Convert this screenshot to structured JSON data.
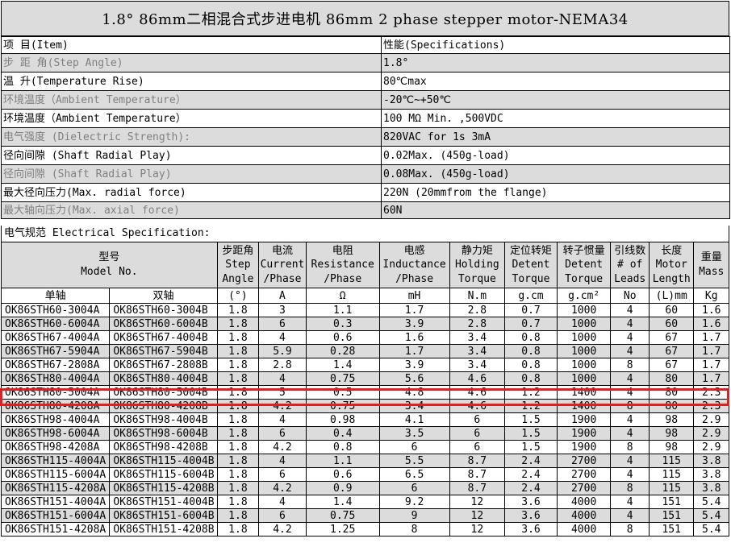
{
  "title": "1.8°  86mm二相混合式步进电机 86mm 2 phase stepper motor-NEMA34",
  "spec_header": {
    "item": "项    目(Item)",
    "value": "性能(Specifications)"
  },
  "specs": [
    {
      "label": "步 距 角(Step Angle)",
      "value": "1.8°",
      "gray": true
    },
    {
      "label": "温    升(Temperature Rise)",
      "value": "80℃max",
      "gray": false
    },
    {
      "label": "环境温度（Ambient Temperature）",
      "value": " -20℃~+50℃",
      "gray": true
    },
    {
      "label": "环境温度（Ambient Temperature）",
      "value": "100 MΩ Min. ,500VDC",
      "gray": false
    },
    {
      "label": "电气强度 (Dielectric Strength):",
      "value": "820VAC for 1s 3mA",
      "gray": true
    },
    {
      "label": "径向间隙 (Shaft Radial Play)",
      "value": "0.02Max. (450g-load)",
      "gray": false
    },
    {
      "label": "径向间隙 (Shaft Radial Play)",
      "value": "0.08Max. (450g-load)",
      "gray": true
    },
    {
      "label": "最大径向压力(Max. radial force)",
      "value": "220N (20mmfrom the flange)",
      "gray": false
    },
    {
      "label": "最大轴向压力(Max. axial force)",
      "value": "60N",
      "gray": true
    }
  ],
  "electrical_label": "电气规范 Electrical Specification:",
  "headers": {
    "model": [
      "型号",
      "Model No."
    ],
    "step": [
      "步距角",
      "Step",
      "Angle"
    ],
    "current": [
      "电流",
      "Current",
      "/Phase"
    ],
    "resistance": [
      "电阻",
      "Resistance",
      "/Phase"
    ],
    "inductance": [
      "电感",
      "Inductance",
      "/Phase"
    ],
    "holding": [
      "静力矩",
      "Holding",
      "Torque"
    ],
    "detent": [
      "定位转矩",
      "Detent",
      "Torque"
    ],
    "inertia": [
      "转子惯量",
      "Detent",
      "Torque"
    ],
    "leads": [
      "引线数",
      "# of",
      "Leads"
    ],
    "length": [
      "长度",
      "Motor",
      "Length"
    ],
    "mass": [
      "重量",
      "Mass"
    ]
  },
  "units": [
    "单轴",
    "双轴",
    "(°)",
    "A",
    "Ω",
    "mH",
    "N.m",
    "g.cm",
    "g.cm²",
    "No",
    "(L)mm",
    "Kg"
  ],
  "rows": [
    [
      "OK86STH60-3004A",
      "OK86STH60-3004B",
      "1.8",
      "3",
      "1.1",
      "1.7",
      "2.8",
      "0.7",
      "1000",
      "4",
      "60",
      "1.6"
    ],
    [
      "OK86STH60-6004A",
      "OK86STH60-6004B",
      "1.8",
      "6",
      "0.3",
      "3.9",
      "2.8",
      "0.7",
      "1000",
      "4",
      "60",
      "1.6"
    ],
    [
      "OK86STH67-4004A",
      "OK86STH67-4004B",
      "1.8",
      "4",
      "0.6",
      "1.6",
      "3.4",
      "0.8",
      "1000",
      "4",
      "67",
      "1.7"
    ],
    [
      "OK86STH67-5904A",
      "OK86STH67-5904B",
      "1.8",
      "5.9",
      "0.28",
      "1.7",
      "3.4",
      "0.8",
      "1000",
      "4",
      "67",
      "1.7"
    ],
    [
      "OK86STH67-2808A",
      "OK86STH67-2808B",
      "1.8",
      "2.8",
      "1.4",
      "3.9",
      "3.4",
      "0.8",
      "1000",
      "8",
      "67",
      "1.7"
    ],
    [
      "OK86STH80-4004A",
      "OK86STH80-4004B",
      "1.8",
      "4",
      "0.75",
      "5.6",
      "4.6",
      "0.8",
      "1000",
      "4",
      "80",
      "1.7"
    ],
    [
      "OK86STH80-5004A",
      "OK86STH80-5004B",
      "1.8",
      "5",
      "0.5",
      "4.8",
      "4.6",
      "1.2",
      "1400",
      "4",
      "80",
      "2.3"
    ],
    [
      "OK86STH80-4208A",
      "OK86STH80-4208B",
      "1.8",
      "4.2",
      "0.75",
      "3.4",
      "4.6",
      "1.2",
      "1400",
      "8",
      "80",
      "2.3"
    ],
    [
      "OK86STH98-4004A",
      "OK86STH98-4004B",
      "1.8",
      "4",
      "0.98",
      "4.1",
      "6",
      "1.5",
      "1900",
      "4",
      "98",
      "2.9"
    ],
    [
      "OK86STH98-6004A",
      "OK86STH98-6004B",
      "1.8",
      "6",
      "0.4",
      "3.5",
      "6",
      "1.5",
      "1900",
      "4",
      "98",
      "2.9"
    ],
    [
      "OK86STH98-4208A",
      "OK86STH98-4208B",
      "1.8",
      "4.2",
      "0.8",
      "6",
      "6",
      "1.5",
      "1900",
      "8",
      "98",
      "2.9"
    ],
    [
      "OK86STH115-4004A",
      "OK86STH115-4004B",
      "1.8",
      "4",
      "1.1",
      "5.5",
      "8.7",
      "2.4",
      "2700",
      "4",
      "115",
      "3.8"
    ],
    [
      "OK86STH115-6004A",
      "OK86STH115-6004B",
      "1.8",
      "6",
      "0.6",
      "6.5",
      "8.7",
      "2.4",
      "2700",
      "4",
      "115",
      "3.8"
    ],
    [
      "OK86STH115-4208A",
      "OK86STH115-4208B",
      "1.8",
      "4.2",
      "0.9",
      "6",
      "8.7",
      "2.4",
      "2700",
      "8",
      "115",
      "3.8"
    ],
    [
      "OK86STH151-4004A",
      "OK86STH151-4004B",
      "1.8",
      "4",
      "1.4",
      "9.2",
      "12",
      "3.6",
      "4000",
      "4",
      "151",
      "5.4"
    ],
    [
      "OK86STH151-6004A",
      "OK86STH151-6004B",
      "1.8",
      "6",
      "0.75",
      "9",
      "12",
      "3.6",
      "4000",
      "4",
      "151",
      "5.4"
    ],
    [
      "OK86STH151-4208A",
      "OK86STH151-4208B",
      "1.8",
      "4.2",
      "1.25",
      "8",
      "12",
      "3.6",
      "4000",
      "8",
      "151",
      "5.4"
    ]
  ],
  "highlight_color": "#e02020",
  "gray_color": "#dcdcdc"
}
